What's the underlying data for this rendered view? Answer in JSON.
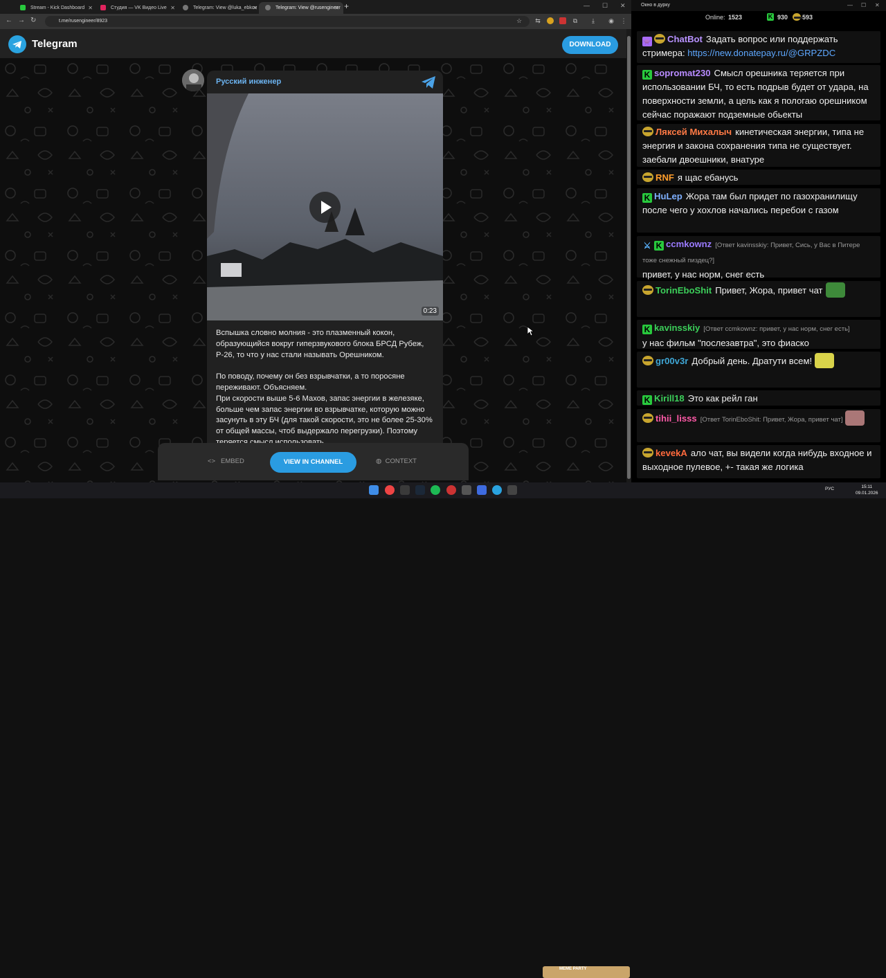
{
  "browser": {
    "tabs": [
      {
        "title": "Stream - Kick Dashboard",
        "active": false
      },
      {
        "title": "Студия — VK Видео Live",
        "active": false
      },
      {
        "title": "Telegram: View @luka_ebkov",
        "active": false
      },
      {
        "title": "Telegram: View @rusengineer",
        "active": true
      }
    ],
    "url": "t.me/rusengineer/8923"
  },
  "telegram": {
    "logo_text": "Telegram",
    "download_label": "DOWNLOAD",
    "channel_name": "Русский инженер",
    "video_duration": "0:23",
    "post_text": "Вспышка словно молния - это плазменный кокон, образующийся вокруг гиперзвукового блока БРСД Рубеж, Р-26, то что у нас стали называть Орешником.\n\nПо поводу, почему он без взрывчатки, а то поросяне переживают. Объясняем.\nПри скорости выше 5-6 Махов, запас энергии в железяке, больше чем запас энергии во взрывчатке, которую можно засунуть в эту БЧ (для такой скорости, это не более 25-30% от общей массы, чтоб выдержало перегрузки). Поэтому теряется смысл использовать",
    "embed_label": "EMBED",
    "view_channel_label": "VIEW IN CHANNEL",
    "context_label": "CONTEXT"
  },
  "chat": {
    "window_title": "Окно в дурку",
    "online_label": "Online:",
    "online_count": "1523",
    "kick_count": "930",
    "other_count": "593",
    "messages": [
      {
        "badges": [
          "ghost",
          "glasses"
        ],
        "nick": "ChatBot",
        "color": "#b892ff",
        "reply": "",
        "text": "Задать вопрос или поддержать стримера: ",
        "link": "https://new.donatepay.ru/@GRPZDC"
      },
      {
        "badges": [
          "kick"
        ],
        "nick": "sopromat230",
        "color": "#b88bff",
        "reply": "",
        "text": "Смысл орешника теряется при использовании БЧ, то есть подрыв будет от удара, на поверхности земли, а цель как я пологаю орешником сейчас поражают подземные обьекты",
        "link": ""
      },
      {
        "badges": [
          "glasses"
        ],
        "nick": "Ляксей Михалыч",
        "color": "#ff7a45",
        "reply": "",
        "text": "кинетическая энергии, типа не энергия и  закона сохранения типа не существует. заебали двоешники, внатуре",
        "link": ""
      },
      {
        "badges": [
          "glasses"
        ],
        "nick": "RNF",
        "color": "#ff9d2b",
        "reply": "",
        "text": "я щас ебанусь",
        "link": ""
      },
      {
        "badges": [
          "kick"
        ],
        "nick": "HuLep",
        "color": "#7fb0ff",
        "reply": "",
        "text": "Жора там был придет по газохранилищу после чего у хохлов начались перебои с газом",
        "link": ""
      },
      {
        "badges": [
          "sword",
          "kick"
        ],
        "nick": "ccmkownz",
        "color": "#9b7bff",
        "reply": "[Ответ kavinsskiy: Привет, Сись, у Вас в Питере тоже снежный пиздец?]",
        "text": "привет, у нас норм, снег есть",
        "link": ""
      },
      {
        "badges": [
          "glasses"
        ],
        "nick": "TorinEboShit",
        "color": "#3ccf5a",
        "reply": "",
        "text": "Привет, Жора, привет чат",
        "link": ""
      },
      {
        "badges": [
          "kick"
        ],
        "nick": "kavinsskiy",
        "color": "#3ccf5a",
        "reply": "[Ответ ccmkownz: привет, у нас норм, снег есть]",
        "text": "у нас фильм \"послезавтра\", это фиаско",
        "link": ""
      },
      {
        "badges": [
          "glasses"
        ],
        "nick": "gr00v3r",
        "color": "#3fa7d6",
        "reply": "",
        "text": "Добрый день. Дратути всем!",
        "link": ""
      },
      {
        "badges": [
          "kick"
        ],
        "nick": "Kirill18",
        "color": "#3ccf5a",
        "reply": "",
        "text": "Это как рейл ган",
        "link": ""
      },
      {
        "badges": [
          "glasses"
        ],
        "nick": "tihii_lisss",
        "color": "#ff5aa8",
        "reply": "[Ответ TorinEboShit: Привет, Жора, привет чат]",
        "text": "",
        "link": ""
      },
      {
        "badges": [
          "glasses"
        ],
        "nick": "kevekA",
        "color": "#ff6a3d",
        "reply": "",
        "text": "ало чат, вы видели когда нибудь входное и выходное пулевое, +- такая же логика",
        "link": ""
      }
    ]
  },
  "taskbar": {
    "lang": "РУС",
    "time": "15:11",
    "date": "09.01.2026",
    "meme_label": "MEME PARTY"
  }
}
